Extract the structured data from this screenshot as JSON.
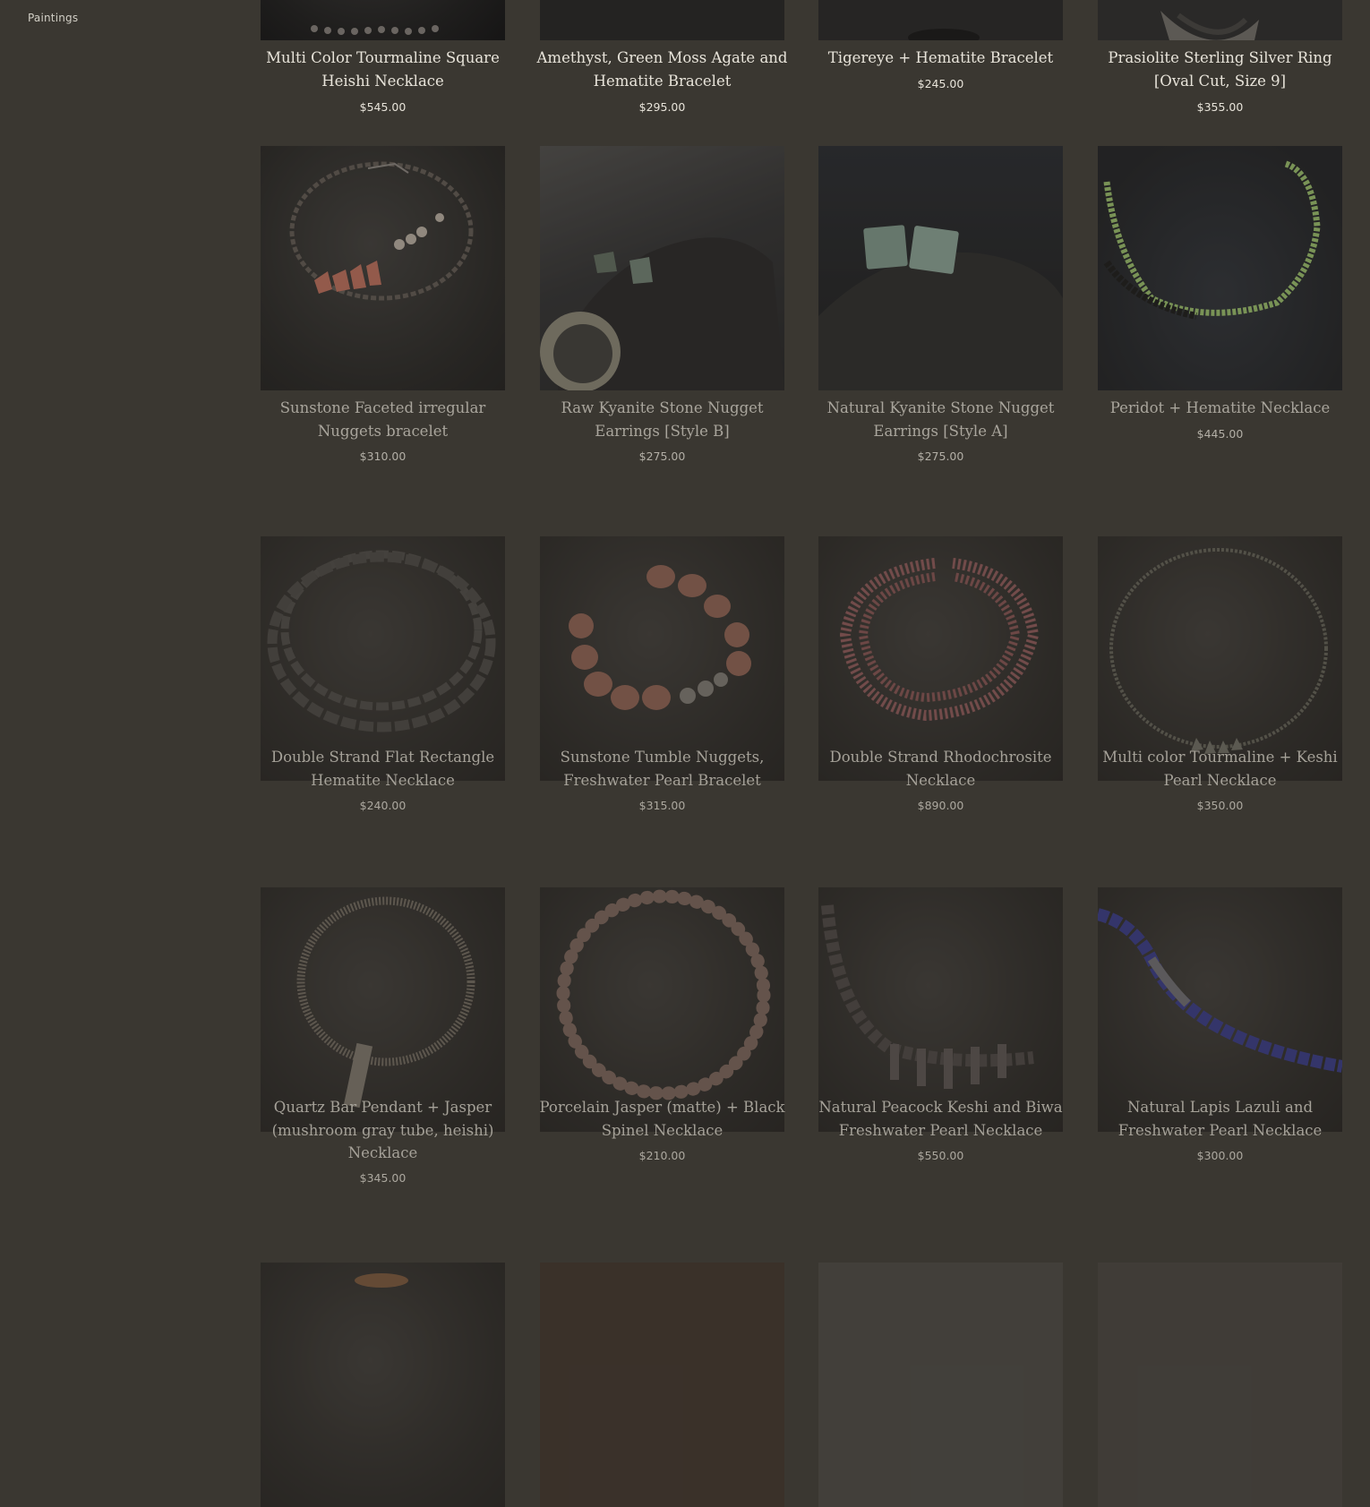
{
  "sidebar": {
    "link_paintings": "Paintings"
  },
  "products": [
    {
      "title": "Multi Color Tourmaline Square Heishi Necklace",
      "price": "$545.00"
    },
    {
      "title": "Amethyst, Green Moss Agate and Hematite Bracelet",
      "price": "$295.00"
    },
    {
      "title": "Tigereye + Hematite Bracelet",
      "price": "$245.00"
    },
    {
      "title": "Prasiolite Sterling Silver Ring [Oval Cut, Size 9]",
      "price": "$355.00"
    },
    {
      "title": "Sunstone Faceted irregular Nuggets bracelet",
      "price": "$310.00"
    },
    {
      "title": "Raw Kyanite Stone Nugget Earrings [Style B]",
      "price": "$275.00"
    },
    {
      "title": "Natural Kyanite Stone Nugget Earrings [Style A]",
      "price": "$275.00"
    },
    {
      "title": "Peridot + Hematite Necklace",
      "price": "$445.00"
    },
    {
      "title": "Double Strand Flat Rectangle Hematite Necklace",
      "price": "$240.00"
    },
    {
      "title": "Sunstone Tumble Nuggets, Freshwater Pearl Bracelet",
      "price": "$315.00"
    },
    {
      "title": "Double Strand Rhodochrosite Necklace",
      "price": "$890.00"
    },
    {
      "title": "Multi color Tourmaline + Keshi Pearl Necklace",
      "price": "$350.00"
    },
    {
      "title": "Quartz Bar Pendant + Jasper (mushroom gray tube, heishi) Necklace",
      "price": "$345.00"
    },
    {
      "title": "Porcelain Jasper (matte) + Black Spinel Necklace",
      "price": "$210.00"
    },
    {
      "title": "Natural Peacock Keshi and Biwa Freshwater Pearl Necklace",
      "price": "$550.00"
    },
    {
      "title": "Natural Lapis Lazuli and Freshwater Pearl Necklace",
      "price": "$300.00"
    }
  ]
}
